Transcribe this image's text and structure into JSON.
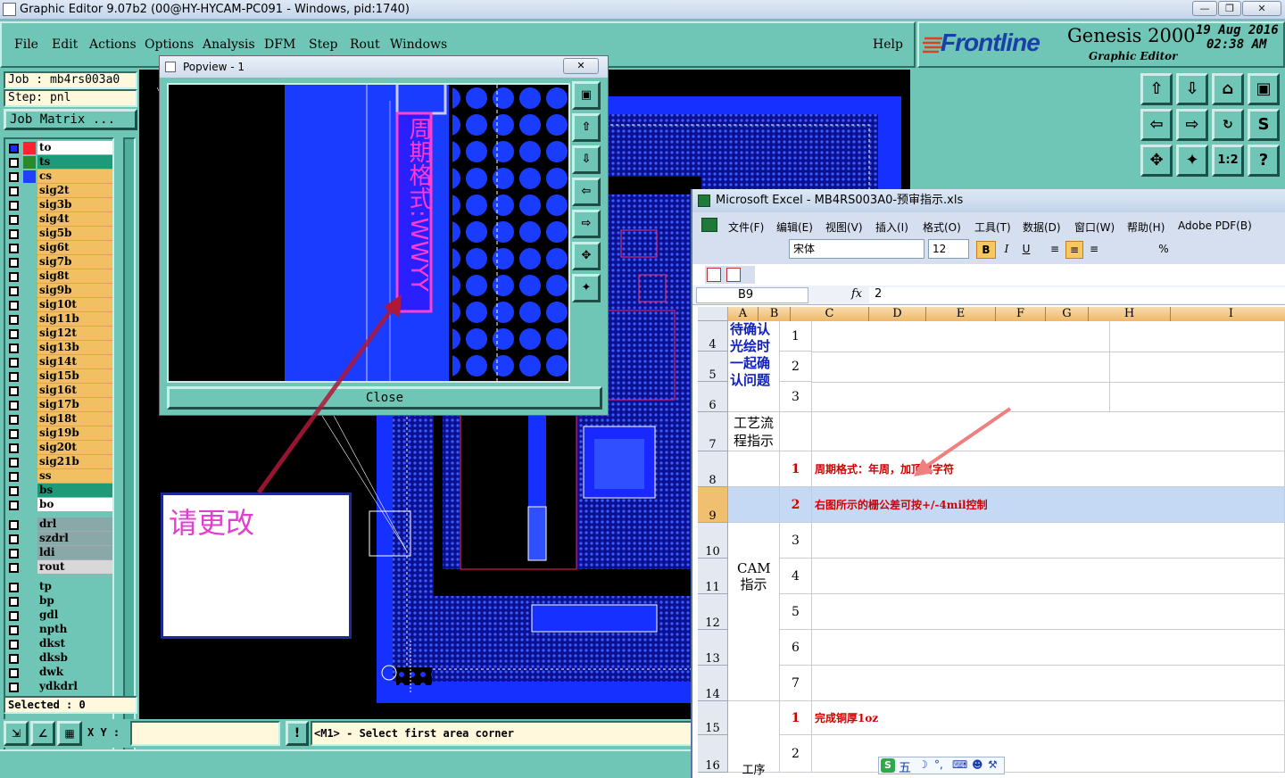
{
  "window": {
    "title": "Graphic Editor 9.07b2 (00@HY-HYCAM-PC091 - Windows, pid:1740)"
  },
  "menu": {
    "items": [
      "File",
      "Edit",
      "Actions",
      "Options",
      "Analysis",
      "DFM",
      "Step",
      "Rout",
      "Windows"
    ],
    "help": "Help"
  },
  "brand": {
    "logo": "Frontline",
    "product": "Genesis 2000",
    "sub": "Graphic Editor",
    "date": "19 Aug 2016",
    "time": "02:38 AM"
  },
  "job": {
    "job": "Job : mb4rs003a0",
    "step": "Step: pnl",
    "matrix_button": "Job Matrix ..."
  },
  "layers": [
    {
      "name": "to",
      "bg": "#ffffff"
    },
    {
      "name": "ts",
      "bg": "#1d9a7a"
    },
    {
      "name": "cs",
      "bg": "#f2c062"
    },
    {
      "name": "sig2t",
      "bg": "#f2c062"
    },
    {
      "name": "sig3b",
      "bg": "#f2c062"
    },
    {
      "name": "sig4t",
      "bg": "#f2c062"
    },
    {
      "name": "sig5b",
      "bg": "#f2c062"
    },
    {
      "name": "sig6t",
      "bg": "#f2c062"
    },
    {
      "name": "sig7b",
      "bg": "#f2c062"
    },
    {
      "name": "sig8t",
      "bg": "#f2c062"
    },
    {
      "name": "sig9b",
      "bg": "#f2c062"
    },
    {
      "name": "sig10t",
      "bg": "#f2c062"
    },
    {
      "name": "sig11b",
      "bg": "#f2c062"
    },
    {
      "name": "sig12t",
      "bg": "#f2c062"
    },
    {
      "name": "sig13b",
      "bg": "#f2c062"
    },
    {
      "name": "sig14t",
      "bg": "#f2c062"
    },
    {
      "name": "sig15b",
      "bg": "#f2c062"
    },
    {
      "name": "sig16t",
      "bg": "#f2c062"
    },
    {
      "name": "sig17b",
      "bg": "#f2c062"
    },
    {
      "name": "sig18t",
      "bg": "#f2c062"
    },
    {
      "name": "sig19b",
      "bg": "#f2c062"
    },
    {
      "name": "sig20t",
      "bg": "#f2c062"
    },
    {
      "name": "sig21b",
      "bg": "#f2c062"
    },
    {
      "name": "ss",
      "bg": "#f2c062"
    },
    {
      "name": "bs",
      "bg": "#1d9a7a"
    },
    {
      "name": "bo",
      "bg": "#ffffff"
    }
  ],
  "layers2": [
    "drl",
    "szdrl",
    "ldi",
    "rout"
  ],
  "layers3": [
    "tp",
    "bp",
    "gdl",
    "npth",
    "dkst",
    "dksb",
    "dwk",
    "ydkdrl"
  ],
  "selected": "Selected : 0",
  "xy_label": "X Y :",
  "prompt": "<M1> - Select first area corner",
  "popview": {
    "title": "Popview - 1",
    "close": "Close",
    "text": "周期格式:WWYY"
  },
  "note": {
    "text": "请更改"
  },
  "excel": {
    "title": "Microsoft Excel - MB4RS003A0-预审指示.xls",
    "menu": [
      "文件(F)",
      "编辑(E)",
      "视图(V)",
      "插入(I)",
      "格式(O)",
      "工具(T)",
      "数据(D)",
      "窗口(W)",
      "帮助(H)",
      "Adobe PDF(B)"
    ],
    "font": "宋体",
    "size": "12",
    "cellref": "B9",
    "formula": "2",
    "columns": [
      "A",
      "B",
      "C",
      "D",
      "E",
      "F",
      "G",
      "H",
      "I"
    ],
    "rows": [
      "4",
      "5",
      "6",
      "7",
      "8",
      "9",
      "10",
      "11",
      "12",
      "13",
      "14",
      "15",
      "16"
    ],
    "a_block1": "待确认光绘时一起确认问题",
    "a_block2": "工艺流程指示",
    "a_block3": "CAM指示",
    "a_block4": "工序",
    "b_values": [
      "1",
      "2",
      "3",
      "1",
      "2",
      "3",
      "4",
      "5",
      "6",
      "7",
      "1",
      "2"
    ],
    "c8": "周期格式：年周，加顶层字符",
    "c9": "右图所示的栅公差可按+/-4mil控制",
    "c15": "完成铜厚1oz"
  },
  "ime": {
    "text": "五"
  }
}
